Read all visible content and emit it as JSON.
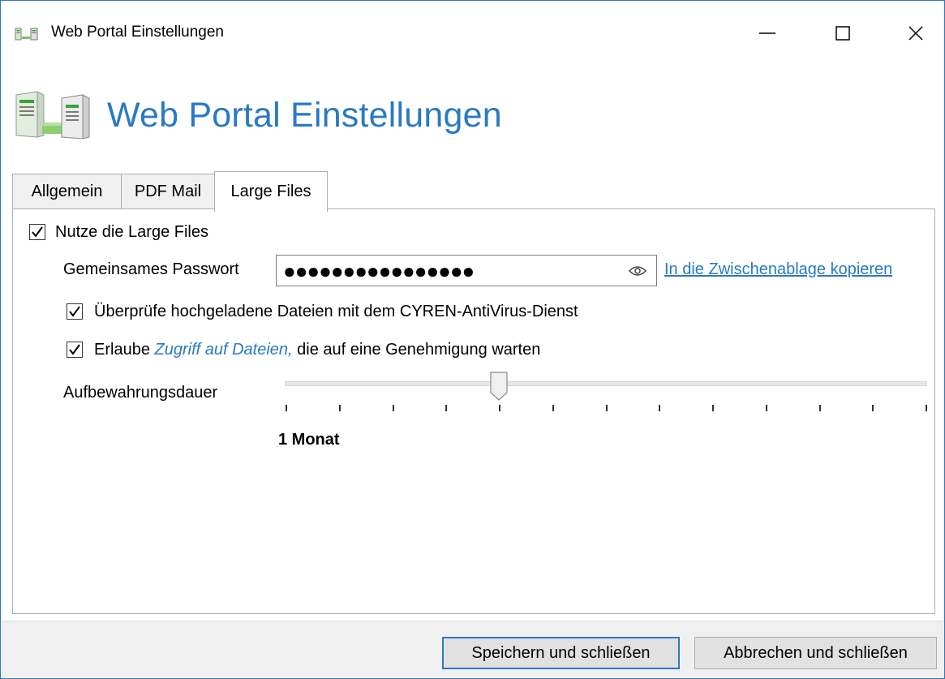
{
  "window": {
    "title": "Web Portal Einstellungen",
    "controls": {
      "minimize": "minimize-icon",
      "maximize": "maximize-icon",
      "close": "close-icon"
    }
  },
  "header": {
    "title": "Web Portal Einstellungen",
    "icon": "server-icon"
  },
  "tabs": [
    {
      "label": "Allgemein",
      "selected": false
    },
    {
      "label": "PDF Mail",
      "selected": false
    },
    {
      "label": "Large Files",
      "selected": true
    }
  ],
  "large_files": {
    "use_large_files": {
      "label": "Nutze die Large Files",
      "checked": true
    },
    "password": {
      "label": "Gemeinsames Passwort",
      "masked_value": "●●●●●●●●●●●●●●●●",
      "reveal_icon": "eye-icon"
    },
    "copy_link": "In die Zwischenablage kopieren",
    "antivirus": {
      "label": "Überprüfe hochgeladene Dateien mit dem CYREN-AntiVirus-Dienst",
      "checked": true
    },
    "allow_access": {
      "prefix": "Erlaube ",
      "link": "Zugriff auf Dateien,",
      "suffix": " die auf eine Genehmigung warten",
      "checked": true
    },
    "retention": {
      "label": "Aufbewahrungsdauer",
      "value_label": "1 Monat",
      "tick_count": 13,
      "selected_index": 4
    }
  },
  "footer": {
    "save_label": "Speichern und schließen",
    "cancel_label": "Abbrechen und schließen"
  },
  "colors": {
    "accent": "#2979c4",
    "window_border": "#2b78c5",
    "footer_bg": "#f0f0f0"
  }
}
